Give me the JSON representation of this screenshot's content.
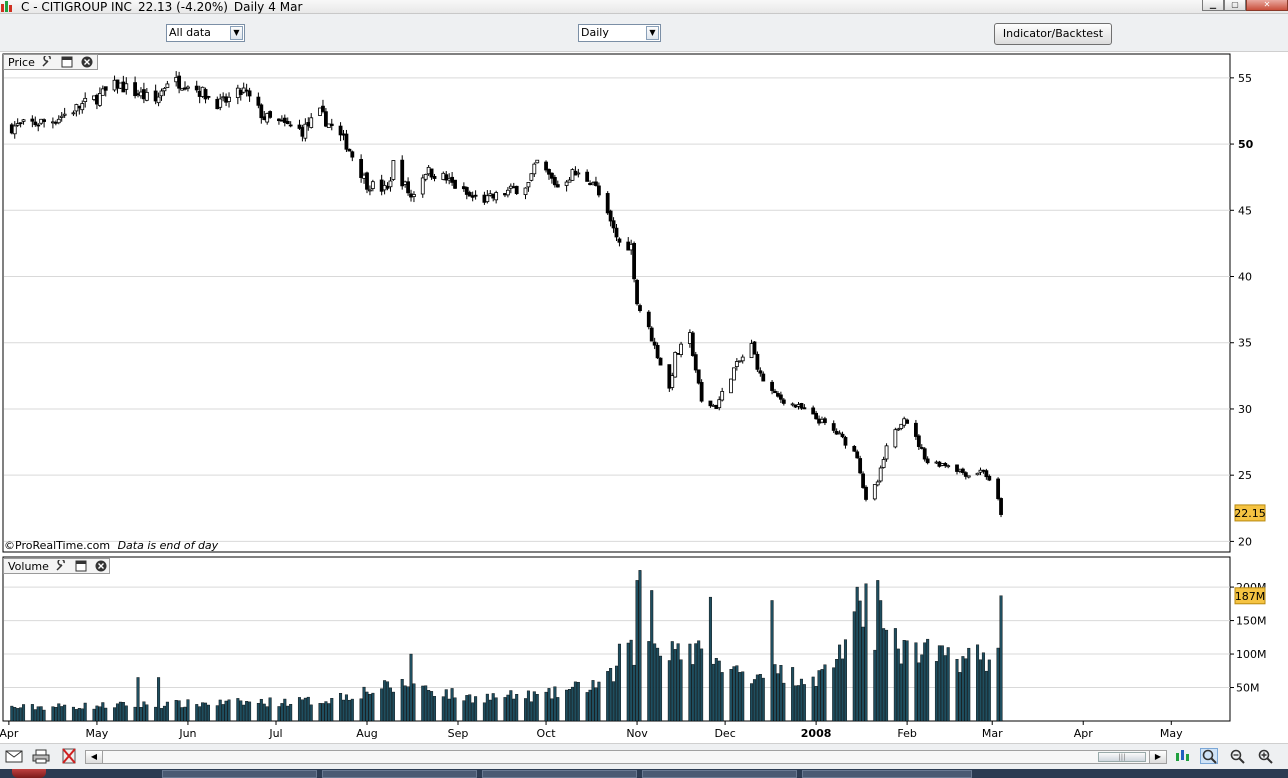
{
  "window": {
    "title_symbol": "C - CITIGROUP INC",
    "title_price": "22.13 (-4.20%)",
    "title_period": "Daily",
    "title_date": "4 Mar"
  },
  "toolbar": {
    "range_select": "All data",
    "period_select": "Daily",
    "indicator_button": "Indicator/Backtest"
  },
  "panels": {
    "price_label": "Price",
    "volume_label": "Volume",
    "footer_source": "©ProRealTime.com",
    "footer_note": "Data is end of day"
  },
  "colors": {
    "candle": "#000000",
    "volume_bar": "#1f4e5f",
    "last_value_badge": "#f5c342",
    "grid": "#d9d9d9"
  },
  "chart_data": [
    {
      "type": "candlestick",
      "panel": "Price",
      "ylim": [
        19.2,
        56.8
      ],
      "y_ticks": [
        20,
        25,
        30,
        35,
        40,
        45,
        50,
        55
      ],
      "bold_tick": 50,
      "last_value": "22.15",
      "x_tick_labels": [
        "Apr",
        "May",
        "Jun",
        "Jul",
        "Aug",
        "Sep",
        "Oct",
        "Nov",
        "Dec",
        "2008",
        "Feb",
        "Mar",
        "Apr",
        "May"
      ],
      "x_tick_dates": [
        "2007-04-01",
        "2007-05-01",
        "2007-06-01",
        "2007-07-01",
        "2007-08-01",
        "2007-09-01",
        "2007-10-01",
        "2007-11-01",
        "2007-12-01",
        "2008-01-01",
        "2008-02-01",
        "2008-03-01",
        "2008-04-01",
        "2008-05-01"
      ],
      "x_domain": [
        "2007-03-30",
        "2008-05-21"
      ],
      "anchors": [
        [
          "2007-04-02",
          51.3
        ],
        [
          "2007-04-16",
          51.8
        ],
        [
          "2007-05-01",
          53.5
        ],
        [
          "2007-05-08",
          54.5
        ],
        [
          "2007-05-21",
          53.2
        ],
        [
          "2007-05-25",
          54.8
        ],
        [
          "2007-06-01",
          54.6
        ],
        [
          "2007-06-12",
          53.0
        ],
        [
          "2007-06-20",
          54.0
        ],
        [
          "2007-06-27",
          52.0
        ],
        [
          "2007-07-03",
          51.5
        ],
        [
          "2007-07-10",
          51.0
        ],
        [
          "2007-07-16",
          52.3
        ],
        [
          "2007-07-25",
          50.0
        ],
        [
          "2007-08-01",
          47.0
        ],
        [
          "2007-08-08",
          46.5
        ],
        [
          "2007-08-10",
          48.5
        ],
        [
          "2007-08-16",
          46.0
        ],
        [
          "2007-08-21",
          48.0
        ],
        [
          "2007-08-27",
          47.5
        ],
        [
          "2007-09-05",
          46.0
        ],
        [
          "2007-09-11",
          45.8
        ],
        [
          "2007-09-25",
          47.0
        ],
        [
          "2007-09-28",
          48.6
        ],
        [
          "2007-10-05",
          46.8
        ],
        [
          "2007-10-10",
          47.8
        ],
        [
          "2007-10-17",
          47.2
        ],
        [
          "2007-10-22",
          44.5
        ],
        [
          "2007-10-26",
          42.5
        ],
        [
          "2007-10-30",
          42.3
        ],
        [
          "2007-11-01",
          38.0
        ],
        [
          "2007-11-05",
          36.0
        ],
        [
          "2007-11-12",
          31.5
        ],
        [
          "2007-11-14",
          34.0
        ],
        [
          "2007-11-19",
          35.5
        ],
        [
          "2007-11-23",
          30.5
        ],
        [
          "2007-11-28",
          30.2
        ],
        [
          "2007-12-04",
          33.0
        ],
        [
          "2007-12-10",
          34.8
        ],
        [
          "2007-12-13",
          32.5
        ],
        [
          "2007-12-18",
          31.0
        ],
        [
          "2007-12-27",
          30.0
        ],
        [
          "2008-01-03",
          29.0
        ],
        [
          "2008-01-09",
          28.0
        ],
        [
          "2008-01-15",
          26.5
        ],
        [
          "2008-01-18",
          23.0
        ],
        [
          "2008-01-22",
          24.5
        ],
        [
          "2008-01-25",
          27.0
        ],
        [
          "2008-01-31",
          29.5
        ],
        [
          "2008-02-08",
          26.0
        ],
        [
          "2008-02-15",
          25.8
        ],
        [
          "2008-02-22",
          25.0
        ],
        [
          "2008-02-27",
          25.4
        ],
        [
          "2008-03-03",
          23.1
        ],
        [
          "2008-03-04",
          22.15
        ]
      ],
      "series": [
        {
          "name": "Volume",
          "type": "bar",
          "panel": "Volume",
          "ylim": [
            0,
            230
          ],
          "y_ticks": [
            50,
            100,
            150,
            200
          ],
          "y_tick_labels": [
            "50M",
            "100M",
            "150M",
            "200M"
          ],
          "last_value": "187M",
          "volume_anchors": [
            [
              "2007-04-02",
              20
            ],
            [
              "2007-05-15",
              24
            ],
            [
              "2007-07-16",
              30
            ],
            [
              "2007-08-01",
              45
            ],
            [
              "2007-08-16",
              55
            ],
            [
              "2007-09-03",
              35
            ],
            [
              "2007-10-01",
              38
            ],
            [
              "2007-10-22",
              60
            ],
            [
              "2007-11-01",
              110
            ],
            [
              "2007-11-15",
              115
            ],
            [
              "2007-12-01",
              75
            ],
            [
              "2007-12-20",
              70
            ],
            [
              "2008-01-02",
              65
            ],
            [
              "2008-01-17",
              150
            ],
            [
              "2008-02-01",
              100
            ],
            [
              "2008-02-28",
              95
            ]
          ],
          "volume_spikes": [
            [
              "2007-05-15",
              65
            ],
            [
              "2007-05-22",
              65
            ],
            [
              "2007-08-16",
              100
            ],
            [
              "2007-10-26",
              115
            ],
            [
              "2007-11-01",
              210
            ],
            [
              "2007-11-02",
              225
            ],
            [
              "2007-11-06",
              195
            ],
            [
              "2007-11-26",
              185
            ],
            [
              "2007-12-17",
              180
            ],
            [
              "2008-01-15",
              200
            ],
            [
              "2008-01-18",
              205
            ],
            [
              "2008-01-22",
              210
            ],
            [
              "2008-01-23",
              180
            ],
            [
              "2008-03-04",
              187
            ]
          ]
        }
      ]
    }
  ]
}
